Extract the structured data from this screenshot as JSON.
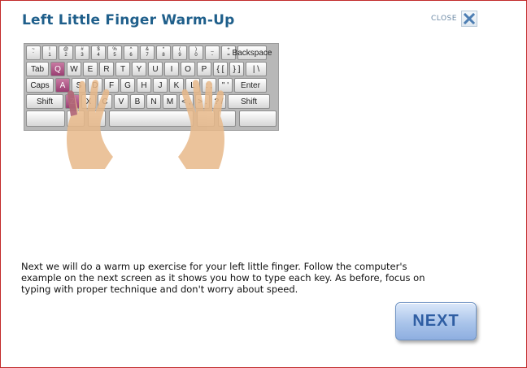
{
  "header": {
    "title": "Left Little Finger Warm-Up",
    "close_label": "CLOSE"
  },
  "keyboard": {
    "row1": [
      "~ `",
      "! 1",
      "@ 2",
      "# 3",
      "$ 4",
      "% 5",
      "^ 6",
      "& 7",
      "* 8",
      "( 9",
      ") 0",
      "_ -",
      "+ =",
      "Backspace"
    ],
    "row2": [
      "Tab",
      "Q",
      "W",
      "E",
      "R",
      "T",
      "Y",
      "U",
      "I",
      "O",
      "P",
      "{ [",
      "} ]",
      "| \\"
    ],
    "row3": [
      "Caps",
      "A",
      "S",
      "D",
      "F",
      "G",
      "H",
      "J",
      "K",
      "L",
      ": ;",
      "\" '",
      "Enter"
    ],
    "row4": [
      "Shift",
      "Z",
      "X",
      "C",
      "V",
      "B",
      "N",
      "M",
      "< ,",
      "> .",
      "? /",
      "Shift"
    ],
    "highlighted_keys": [
      "Q",
      "A",
      "Z"
    ],
    "highlight_color": "#9a3f72"
  },
  "instructions": "Next we will do a warm up exercise for your left little finger. Follow the computer's example on the next screen as it shows you how to type each key. As before, focus on typing with proper technique and don't worry about speed.",
  "next_button_label": "NEXT",
  "colors": {
    "title": "#1f5f8b",
    "border": "#c22a2a",
    "button": "#a9c4ea"
  }
}
